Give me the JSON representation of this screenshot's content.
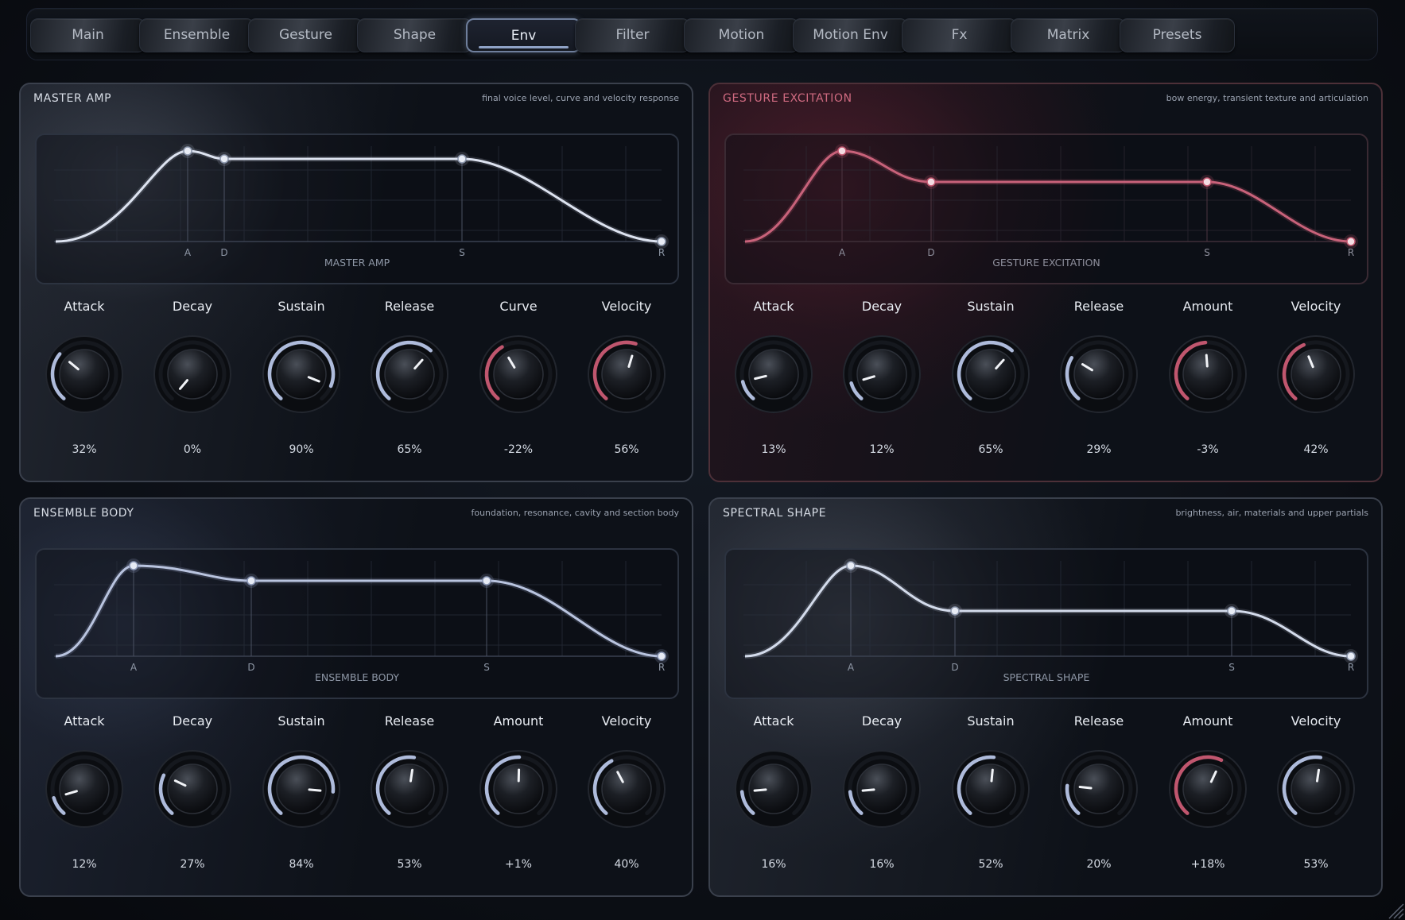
{
  "tabs": [
    {
      "label": "Main",
      "active": false
    },
    {
      "label": "Ensemble",
      "active": false
    },
    {
      "label": "Gesture",
      "active": false
    },
    {
      "label": "Shape",
      "active": false
    },
    {
      "label": "Env",
      "active": true
    },
    {
      "label": "Filter",
      "active": false
    },
    {
      "label": "Motion",
      "active": false
    },
    {
      "label": "Motion Env",
      "active": false
    },
    {
      "label": "Fx",
      "active": false
    },
    {
      "label": "Matrix",
      "active": false
    },
    {
      "label": "Presets",
      "active": false
    }
  ],
  "colors": {
    "accent_blue": "#aebbdb",
    "accent_red": "#c0566e",
    "panel_border": "#3a404c"
  },
  "panels": [
    {
      "title": "MASTER AMP",
      "subtitle": "final voice level, curve and velocity response",
      "graph_label": "MASTER AMP",
      "theme": "blue",
      "stage_labels": [
        "A",
        "D",
        "S",
        "R"
      ],
      "knobs": [
        {
          "label": "Attack",
          "value": "32%",
          "level": 0.32,
          "accent": "blue"
        },
        {
          "label": "Decay",
          "value": "0%",
          "level": 0.0,
          "accent": "blue"
        },
        {
          "label": "Sustain",
          "value": "90%",
          "level": 0.9,
          "accent": "blue"
        },
        {
          "label": "Release",
          "value": "65%",
          "level": 0.65,
          "accent": "blue"
        },
        {
          "label": "Curve",
          "value": "-22%",
          "level": 0.39,
          "accent": "red"
        },
        {
          "label": "Velocity",
          "value": "56%",
          "level": 0.56,
          "accent": "red"
        }
      ]
    },
    {
      "title": "GESTURE EXCITATION",
      "subtitle": "bow energy, transient texture and articulation",
      "graph_label": "GESTURE EXCITATION",
      "theme": "red",
      "stage_labels": [
        "A",
        "D",
        "S",
        "R"
      ],
      "knobs": [
        {
          "label": "Attack",
          "value": "13%",
          "level": 0.13,
          "accent": "blue"
        },
        {
          "label": "Decay",
          "value": "12%",
          "level": 0.12,
          "accent": "blue"
        },
        {
          "label": "Sustain",
          "value": "65%",
          "level": 0.65,
          "accent": "blue"
        },
        {
          "label": "Release",
          "value": "29%",
          "level": 0.29,
          "accent": "blue"
        },
        {
          "label": "Amount",
          "value": "-3%",
          "level": 0.485,
          "accent": "red"
        },
        {
          "label": "Velocity",
          "value": "42%",
          "level": 0.42,
          "accent": "red"
        }
      ]
    },
    {
      "title": "ENSEMBLE BODY",
      "subtitle": "foundation, resonance, cavity and section body",
      "graph_label": "ENSEMBLE BODY",
      "theme": "blue",
      "stage_labels": [
        "A",
        "D",
        "S",
        "R"
      ],
      "knobs": [
        {
          "label": "Attack",
          "value": "12%",
          "level": 0.12,
          "accent": "blue"
        },
        {
          "label": "Decay",
          "value": "27%",
          "level": 0.27,
          "accent": "blue"
        },
        {
          "label": "Sustain",
          "value": "84%",
          "level": 0.84,
          "accent": "blue"
        },
        {
          "label": "Release",
          "value": "53%",
          "level": 0.53,
          "accent": "blue"
        },
        {
          "label": "Amount",
          "value": "+1%",
          "level": 0.505,
          "accent": "blue"
        },
        {
          "label": "Velocity",
          "value": "40%",
          "level": 0.4,
          "accent": "blue"
        }
      ]
    },
    {
      "title": "SPECTRAL SHAPE",
      "subtitle": "brightness, air, materials and upper partials",
      "graph_label": "SPECTRAL SHAPE",
      "theme": "blue",
      "stage_labels": [
        "A",
        "D",
        "S",
        "R"
      ],
      "knobs": [
        {
          "label": "Attack",
          "value": "16%",
          "level": 0.16,
          "accent": "blue"
        },
        {
          "label": "Decay",
          "value": "16%",
          "level": 0.16,
          "accent": "blue"
        },
        {
          "label": "Sustain",
          "value": "52%",
          "level": 0.52,
          "accent": "blue"
        },
        {
          "label": "Release",
          "value": "20%",
          "level": 0.2,
          "accent": "blue"
        },
        {
          "label": "Amount",
          "value": "+18%",
          "level": 0.59,
          "accent": "red"
        },
        {
          "label": "Velocity",
          "value": "53%",
          "level": 0.53,
          "accent": "blue"
        }
      ]
    }
  ]
}
